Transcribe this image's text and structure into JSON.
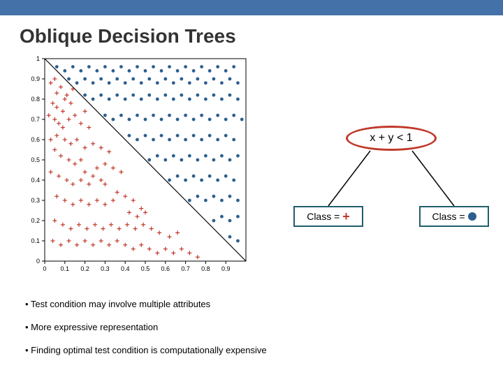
{
  "header": {
    "title": "Oblique Decision Trees"
  },
  "chart_data": {
    "type": "scatter",
    "title": "",
    "xlabel": "",
    "ylabel": "",
    "xlim": [
      0,
      1
    ],
    "ylim": [
      0,
      1
    ],
    "xticks": [
      0,
      0.1,
      0.2,
      0.3,
      0.4,
      0.5,
      0.6,
      0.7,
      0.8,
      0.9
    ],
    "yticks": [
      0,
      0.1,
      0.2,
      0.3,
      0.4,
      0.5,
      0.6,
      0.7,
      0.8,
      0.9,
      1
    ],
    "boundary_line": {
      "equation": "x + y = 1",
      "points": [
        [
          0,
          1
        ],
        [
          1,
          0
        ]
      ]
    },
    "series": [
      {
        "name": "plus",
        "color": "#c0392b",
        "marker": "+",
        "points": [
          [
            0.03,
            0.88
          ],
          [
            0.05,
            0.9
          ],
          [
            0.06,
            0.83
          ],
          [
            0.08,
            0.86
          ],
          [
            0.1,
            0.8
          ],
          [
            0.04,
            0.78
          ],
          [
            0.06,
            0.76
          ],
          [
            0.09,
            0.74
          ],
          [
            0.11,
            0.82
          ],
          [
            0.13,
            0.78
          ],
          [
            0.14,
            0.85
          ],
          [
            0.05,
            0.7
          ],
          [
            0.07,
            0.68
          ],
          [
            0.09,
            0.66
          ],
          [
            0.12,
            0.7
          ],
          [
            0.15,
            0.72
          ],
          [
            0.03,
            0.6
          ],
          [
            0.06,
            0.62
          ],
          [
            0.1,
            0.6
          ],
          [
            0.13,
            0.58
          ],
          [
            0.16,
            0.6
          ],
          [
            0.05,
            0.55
          ],
          [
            0.08,
            0.52
          ],
          [
            0.12,
            0.5
          ],
          [
            0.15,
            0.48
          ],
          [
            0.18,
            0.5
          ],
          [
            0.03,
            0.44
          ],
          [
            0.07,
            0.42
          ],
          [
            0.11,
            0.4
          ],
          [
            0.14,
            0.38
          ],
          [
            0.18,
            0.4
          ],
          [
            0.22,
            0.38
          ],
          [
            0.2,
            0.44
          ],
          [
            0.24,
            0.42
          ],
          [
            0.26,
            0.46
          ],
          [
            0.28,
            0.4
          ],
          [
            0.3,
            0.38
          ],
          [
            0.06,
            0.32
          ],
          [
            0.1,
            0.3
          ],
          [
            0.14,
            0.28
          ],
          [
            0.18,
            0.3
          ],
          [
            0.22,
            0.28
          ],
          [
            0.26,
            0.3
          ],
          [
            0.3,
            0.28
          ],
          [
            0.34,
            0.3
          ],
          [
            0.05,
            0.2
          ],
          [
            0.09,
            0.18
          ],
          [
            0.13,
            0.16
          ],
          [
            0.17,
            0.18
          ],
          [
            0.21,
            0.16
          ],
          [
            0.25,
            0.18
          ],
          [
            0.29,
            0.16
          ],
          [
            0.33,
            0.18
          ],
          [
            0.37,
            0.16
          ],
          [
            0.41,
            0.18
          ],
          [
            0.45,
            0.16
          ],
          [
            0.49,
            0.18
          ],
          [
            0.53,
            0.16
          ],
          [
            0.57,
            0.14
          ],
          [
            0.04,
            0.1
          ],
          [
            0.08,
            0.08
          ],
          [
            0.12,
            0.1
          ],
          [
            0.16,
            0.08
          ],
          [
            0.2,
            0.1
          ],
          [
            0.24,
            0.08
          ],
          [
            0.28,
            0.1
          ],
          [
            0.32,
            0.08
          ],
          [
            0.36,
            0.1
          ],
          [
            0.4,
            0.08
          ],
          [
            0.44,
            0.06
          ],
          [
            0.48,
            0.08
          ],
          [
            0.52,
            0.06
          ],
          [
            0.56,
            0.04
          ],
          [
            0.6,
            0.06
          ],
          [
            0.64,
            0.04
          ],
          [
            0.68,
            0.06
          ],
          [
            0.72,
            0.04
          ],
          [
            0.76,
            0.02
          ],
          [
            0.62,
            0.12
          ],
          [
            0.66,
            0.14
          ],
          [
            0.3,
            0.48
          ],
          [
            0.34,
            0.46
          ],
          [
            0.38,
            0.44
          ],
          [
            0.36,
            0.34
          ],
          [
            0.4,
            0.32
          ],
          [
            0.44,
            0.3
          ],
          [
            0.48,
            0.26
          ],
          [
            0.42,
            0.24
          ],
          [
            0.46,
            0.22
          ],
          [
            0.5,
            0.24
          ],
          [
            0.32,
            0.54
          ],
          [
            0.28,
            0.56
          ],
          [
            0.24,
            0.58
          ],
          [
            0.2,
            0.56
          ],
          [
            0.18,
            0.68
          ],
          [
            0.22,
            0.66
          ],
          [
            0.02,
            0.72
          ],
          [
            0.2,
            0.74
          ]
        ]
      },
      {
        "name": "dot",
        "color": "#2c5f8f",
        "marker": "o",
        "points": [
          [
            0.06,
            0.96
          ],
          [
            0.1,
            0.94
          ],
          [
            0.14,
            0.96
          ],
          [
            0.18,
            0.94
          ],
          [
            0.22,
            0.96
          ],
          [
            0.26,
            0.94
          ],
          [
            0.3,
            0.96
          ],
          [
            0.34,
            0.94
          ],
          [
            0.38,
            0.96
          ],
          [
            0.42,
            0.94
          ],
          [
            0.46,
            0.96
          ],
          [
            0.5,
            0.94
          ],
          [
            0.54,
            0.96
          ],
          [
            0.58,
            0.94
          ],
          [
            0.62,
            0.96
          ],
          [
            0.66,
            0.94
          ],
          [
            0.7,
            0.96
          ],
          [
            0.74,
            0.94
          ],
          [
            0.78,
            0.96
          ],
          [
            0.82,
            0.94
          ],
          [
            0.86,
            0.96
          ],
          [
            0.9,
            0.94
          ],
          [
            0.94,
            0.96
          ],
          [
            0.12,
            0.9
          ],
          [
            0.16,
            0.88
          ],
          [
            0.2,
            0.9
          ],
          [
            0.24,
            0.88
          ],
          [
            0.28,
            0.9
          ],
          [
            0.32,
            0.88
          ],
          [
            0.36,
            0.9
          ],
          [
            0.4,
            0.88
          ],
          [
            0.44,
            0.9
          ],
          [
            0.48,
            0.88
          ],
          [
            0.52,
            0.9
          ],
          [
            0.56,
            0.88
          ],
          [
            0.6,
            0.9
          ],
          [
            0.64,
            0.88
          ],
          [
            0.68,
            0.9
          ],
          [
            0.72,
            0.88
          ],
          [
            0.76,
            0.9
          ],
          [
            0.8,
            0.88
          ],
          [
            0.84,
            0.9
          ],
          [
            0.88,
            0.88
          ],
          [
            0.92,
            0.9
          ],
          [
            0.96,
            0.88
          ],
          [
            0.2,
            0.82
          ],
          [
            0.24,
            0.8
          ],
          [
            0.28,
            0.82
          ],
          [
            0.32,
            0.8
          ],
          [
            0.36,
            0.82
          ],
          [
            0.4,
            0.8
          ],
          [
            0.44,
            0.82
          ],
          [
            0.48,
            0.8
          ],
          [
            0.52,
            0.82
          ],
          [
            0.56,
            0.8
          ],
          [
            0.6,
            0.82
          ],
          [
            0.64,
            0.8
          ],
          [
            0.68,
            0.82
          ],
          [
            0.72,
            0.8
          ],
          [
            0.76,
            0.82
          ],
          [
            0.8,
            0.8
          ],
          [
            0.84,
            0.82
          ],
          [
            0.88,
            0.8
          ],
          [
            0.92,
            0.82
          ],
          [
            0.96,
            0.8
          ],
          [
            0.3,
            0.72
          ],
          [
            0.34,
            0.7
          ],
          [
            0.38,
            0.72
          ],
          [
            0.42,
            0.7
          ],
          [
            0.46,
            0.72
          ],
          [
            0.5,
            0.7
          ],
          [
            0.54,
            0.72
          ],
          [
            0.58,
            0.7
          ],
          [
            0.62,
            0.72
          ],
          [
            0.66,
            0.7
          ],
          [
            0.7,
            0.72
          ],
          [
            0.74,
            0.7
          ],
          [
            0.78,
            0.72
          ],
          [
            0.82,
            0.7
          ],
          [
            0.86,
            0.72
          ],
          [
            0.9,
            0.7
          ],
          [
            0.94,
            0.72
          ],
          [
            0.98,
            0.7
          ],
          [
            0.42,
            0.62
          ],
          [
            0.46,
            0.6
          ],
          [
            0.5,
            0.62
          ],
          [
            0.54,
            0.6
          ],
          [
            0.58,
            0.62
          ],
          [
            0.62,
            0.6
          ],
          [
            0.66,
            0.62
          ],
          [
            0.7,
            0.6
          ],
          [
            0.74,
            0.62
          ],
          [
            0.78,
            0.6
          ],
          [
            0.82,
            0.62
          ],
          [
            0.86,
            0.6
          ],
          [
            0.9,
            0.62
          ],
          [
            0.94,
            0.6
          ],
          [
            0.52,
            0.5
          ],
          [
            0.56,
            0.52
          ],
          [
            0.6,
            0.5
          ],
          [
            0.64,
            0.52
          ],
          [
            0.68,
            0.5
          ],
          [
            0.72,
            0.52
          ],
          [
            0.76,
            0.5
          ],
          [
            0.8,
            0.52
          ],
          [
            0.84,
            0.5
          ],
          [
            0.88,
            0.52
          ],
          [
            0.92,
            0.5
          ],
          [
            0.96,
            0.52
          ],
          [
            0.62,
            0.4
          ],
          [
            0.66,
            0.42
          ],
          [
            0.7,
            0.4
          ],
          [
            0.74,
            0.42
          ],
          [
            0.78,
            0.4
          ],
          [
            0.82,
            0.42
          ],
          [
            0.86,
            0.4
          ],
          [
            0.9,
            0.42
          ],
          [
            0.94,
            0.4
          ],
          [
            0.72,
            0.3
          ],
          [
            0.76,
            0.32
          ],
          [
            0.8,
            0.3
          ],
          [
            0.84,
            0.32
          ],
          [
            0.88,
            0.3
          ],
          [
            0.92,
            0.32
          ],
          [
            0.96,
            0.3
          ],
          [
            0.84,
            0.2
          ],
          [
            0.88,
            0.22
          ],
          [
            0.92,
            0.2
          ],
          [
            0.96,
            0.22
          ],
          [
            0.92,
            0.12
          ],
          [
            0.96,
            0.1
          ]
        ]
      }
    ]
  },
  "tree": {
    "root_condition": "x + y < 1",
    "left_label_prefix": "Class = ",
    "left_symbol": "+",
    "right_label_prefix": "Class = ",
    "right_symbol": "dot"
  },
  "bullets": [
    "• Test condition may involve multiple attributes",
    "• More expressive representation",
    "• Finding optimal test condition is computationally expensive"
  ],
  "colors": {
    "accent": "#4472a8",
    "plus": "#c0392b",
    "dot": "#2c5f8f",
    "leaf_border": "#1f5f6b"
  }
}
